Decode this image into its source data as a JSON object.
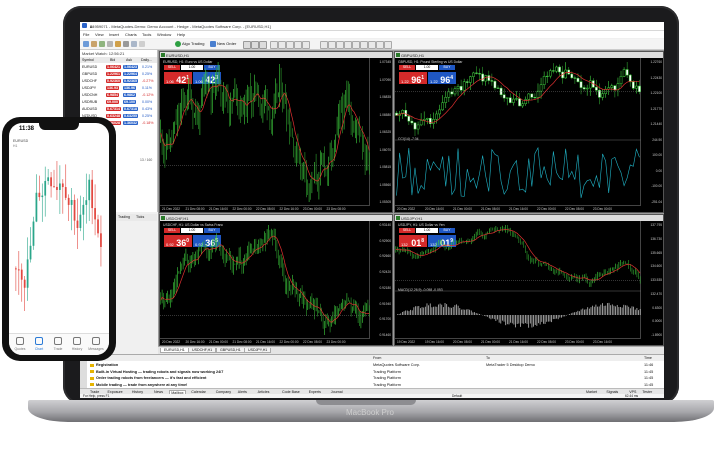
{
  "device": {
    "laptop_brand": "MacBook Pro"
  },
  "window": {
    "title": "84959071 - MetaQuotes-Demo: Demo Account - Hedge - MetaQuotes Software Corp. - [EURUSD,H1]"
  },
  "menu": [
    "File",
    "View",
    "Insert",
    "Charts",
    "Tools",
    "Window",
    "Help"
  ],
  "toolbar": {
    "algo_trading": "Algo Trading",
    "new_order": "New Order"
  },
  "market_watch": {
    "title": "Market Watch: 12:56:21",
    "columns": [
      "Symbol",
      "Bid",
      "Ask",
      "Daily..."
    ],
    "rows": [
      {
        "symbol": "EURUSD",
        "bid": "1.06421",
        "ask": "1.06423",
        "daily": "0.21%"
      },
      {
        "symbol": "GBPUSD",
        "bid": "1.22961",
        "ask": "1.22964",
        "daily": "0.25%"
      },
      {
        "symbol": "USDCHF",
        "bid": "0.92360",
        "ask": "0.92365",
        "daily": "-0.27%"
      },
      {
        "symbol": "USDJPY",
        "bid": "136.93",
        "ask": "136.96",
        "daily": "0.11%"
      },
      {
        "symbol": "USDCNH",
        "bid": "6.9854",
        "ask": "6.9862",
        "daily": "-0.12%"
      },
      {
        "symbol": "USDRUB",
        "bid": "69.000",
        "ask": "69.100",
        "daily": "0.00%"
      },
      {
        "symbol": "AUDUSD",
        "bid": "0.67314",
        "ask": "0.67318",
        "daily": "0.43%"
      },
      {
        "symbol": "NZDUSD",
        "bid": "0.63248",
        "ask": "0.63255",
        "daily": "0.25%"
      },
      {
        "symbol": "USDCAD",
        "bid": "1.36028",
        "ask": "1.36032",
        "daily": "-0.18%"
      }
    ],
    "count": "13 / 160",
    "tabs": [
      "Symbols",
      "Details",
      "Trading",
      "Ticks"
    ]
  },
  "charts": [
    {
      "title": "EURUSD,H1",
      "subtitle": "EURUSD, H1: Euro vs US Dollar",
      "sell_label": "SELL",
      "buy_label": "BUY",
      "lot": "1.00",
      "sell_pre": "1.06",
      "sell_big": "42",
      "sell_sup": "1",
      "buy_pre": "1.06",
      "buy_big": "42",
      "buy_sup": "3",
      "y_ticks": [
        "1.07345",
        "1.07090",
        "1.06835",
        "1.06580",
        "1.06325",
        "1.06070",
        "1.05815",
        "1.05560",
        "1.05305"
      ],
      "x_ticks": [
        "21 Dec 2022",
        "21 Dec 08:00",
        "21 Dec 16:00",
        "22 Dec 00:00",
        "22 Dec 08:00",
        "22 Dec 16:00",
        "23 Dec 00:00",
        "23 Dec 08:00"
      ]
    },
    {
      "title": "GBPUSD,H1",
      "subtitle": "GBPUSD, H1: Pound Sterling vs US Dollar",
      "sell_label": "SELL",
      "buy_label": "BUY",
      "lot": "1.00",
      "sell_pre": "1.22",
      "sell_big": "96",
      "sell_sup": "1",
      "buy_pre": "1.22",
      "buy_big": "96",
      "buy_sup": "4",
      "indicator": "CCI(14) -7.04",
      "y_ticks": [
        "1.22760",
        "1.22430",
        "1.22100",
        "1.21770",
        "1.21440",
        "244.90",
        "100.00",
        "0.00",
        "-100.00",
        "-251.04"
      ],
      "x_ticks": [
        "20 Dec 2022",
        "20 Dec 16:00",
        "21 Dec 00:00",
        "21 Dec 08:00",
        "21 Dec 16:00",
        "22 Dec 00:00",
        "22 Dec 08:00",
        "23 Dec 00:00"
      ]
    },
    {
      "title": "USDCHF,H1",
      "subtitle": "USDCHF, H1: US Dollar vs Swiss Franc",
      "sell_label": "SELL",
      "buy_label": "BUY",
      "lot": "1.00",
      "sell_pre": "0.92",
      "sell_big": "36",
      "sell_sup": "0",
      "buy_pre": "0.92",
      "buy_big": "36",
      "buy_sup": "5",
      "y_ticks": [
        "0.93140",
        "0.92900",
        "0.92660",
        "0.92420",
        "0.92180",
        "0.91940",
        "0.91700",
        "0.91460"
      ],
      "x_ticks": [
        "20 Dec 2022",
        "20 Dec 16:00",
        "21 Dec 00:00",
        "21 Dec 08:00",
        "21 Dec 16:00",
        "22 Dec 00:00",
        "22 Dec 08:00",
        "23 Dec 00:00"
      ]
    },
    {
      "title": "USDJPY,H1",
      "subtitle": "USDJPY, H1: US Dollar vs Yen",
      "sell_label": "SELL",
      "buy_label": "BUY",
      "lot": "1.00",
      "sell_pre": "132",
      "sell_big": "01",
      "sell_sup": "8",
      "buy_pre": "132",
      "buy_big": "01",
      "buy_sup": "9",
      "indicator": "MACD(12,26,9) -0.058 -0.053",
      "y_ticks": [
        "137.795",
        "136.730",
        "135.665",
        "134.600",
        "133.535",
        "132.470",
        "0.6300",
        "0.0000",
        "-1.8900"
      ],
      "x_ticks": [
        "19 Dec 2022",
        "19 Dec 16:00",
        "20 Dec 08:00",
        "21 Dec 00:00",
        "21 Dec 16:00",
        "22 Dec 08:00",
        "23 Dec 00:00",
        "23 Dec 16:00"
      ]
    }
  ],
  "chart_tabs": [
    "EURUSD,H1",
    "USDCHF,H1",
    "GBPUSD,H1",
    "USDJPY,H1"
  ],
  "toolbox": {
    "columns": [
      "Subject",
      "From",
      "To",
      "Time"
    ],
    "rows": [
      {
        "subject": "Registration",
        "from": "MetaQuotes Software Corp.",
        "to": "MetaTrader 5 Desktop Demo",
        "time": "11:46"
      },
      {
        "subject": "Built-in Virtual Hosting — trading robots and signals now working 24/7",
        "from": "Trading Platform",
        "to": "",
        "time": "11:45"
      },
      {
        "subject": "Order trading robots from freelancers — it's fast and efficient",
        "from": "Trading Platform",
        "to": "",
        "time": "11:45"
      },
      {
        "subject": "Mobile trading — trade from anywhere at any time!",
        "from": "Trading Platform",
        "to": "",
        "time": "11:45"
      }
    ],
    "side_label": "Toolbox"
  },
  "bottom_tabs": [
    "Trade",
    "Exposure",
    "History",
    "News",
    "Mailbox",
    "Calendar",
    "Company",
    "Alerts",
    "Articles",
    "Code Base",
    "Experts",
    "Journal"
  ],
  "bottom_right": [
    "Market",
    "Signals",
    "VPS",
    "Tester"
  ],
  "status": {
    "help": "For Help, press F1",
    "profile": "Default",
    "ping": "62.44 ms"
  },
  "phone": {
    "time": "11:38",
    "symbol": "EURUSD",
    "timeframe": "H1",
    "tabs": [
      "Quotes",
      "Chart",
      "Trade",
      "History",
      "Messages"
    ]
  }
}
